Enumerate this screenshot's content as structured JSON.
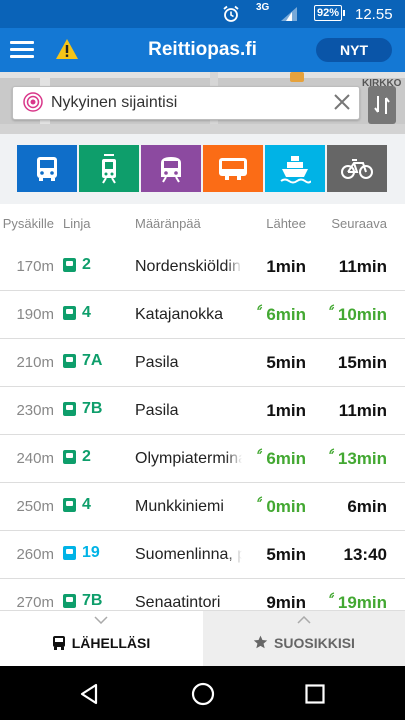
{
  "status": {
    "network": "3G",
    "battery": "92%",
    "time": "12.55"
  },
  "appbar": {
    "title": "Reittiopas.fi",
    "now_button": "NYT"
  },
  "map": {
    "street_label": "KIRKKO"
  },
  "search": {
    "value": "Nykyinen sijaintisi"
  },
  "modes": [
    {
      "name": "bus",
      "color": "#0f6ec9"
    },
    {
      "name": "tram",
      "color": "#0e9e6b"
    },
    {
      "name": "train",
      "color": "#8c4aa0"
    },
    {
      "name": "metro",
      "color": "#fb6c16"
    },
    {
      "name": "ferry",
      "color": "#00b3e6"
    },
    {
      "name": "bike",
      "color": "#666666"
    }
  ],
  "columns": {
    "stop": "Pysäkille",
    "line": "Linja",
    "destination": "Määränpää",
    "departs": "Lähtee",
    "next": "Seuraava"
  },
  "rows": [
    {
      "distance": "170m",
      "line": "2",
      "type": "tram",
      "destination": "Nordenskiöldinkatu",
      "departs": "1min",
      "departs_realtime": false,
      "next": "11min",
      "next_realtime": false
    },
    {
      "distance": "190m",
      "line": "4",
      "type": "tram",
      "destination": "Katajanokka",
      "departs": "6min",
      "departs_realtime": true,
      "next": "10min",
      "next_realtime": true
    },
    {
      "distance": "210m",
      "line": "7A",
      "type": "tram",
      "destination": "Pasila",
      "departs": "5min",
      "departs_realtime": false,
      "next": "15min",
      "next_realtime": false
    },
    {
      "distance": "230m",
      "line": "7B",
      "type": "tram",
      "destination": "Pasila",
      "departs": "1min",
      "departs_realtime": false,
      "next": "11min",
      "next_realtime": false
    },
    {
      "distance": "240m",
      "line": "2",
      "type": "tram",
      "destination": "Olympiaterminaali",
      "departs": "6min",
      "departs_realtime": true,
      "next": "13min",
      "next_realtime": true
    },
    {
      "distance": "250m",
      "line": "4",
      "type": "tram",
      "destination": "Munkkiniemi",
      "departs": "0min",
      "departs_realtime": true,
      "next": "6min",
      "next_realtime": false
    },
    {
      "distance": "260m",
      "line": "19",
      "type": "ferry",
      "destination": "Suomenlinna, pääl",
      "departs": "5min",
      "departs_realtime": false,
      "next": "13:40",
      "next_realtime": false
    },
    {
      "distance": "270m",
      "line": "7B",
      "type": "tram",
      "destination": "Senaatintori",
      "departs": "9min",
      "departs_realtime": false,
      "next": "19min",
      "next_realtime": true
    }
  ],
  "tabs": {
    "nearby": "LÄHELLÄSI",
    "favorites": "SUOSIKKISI"
  },
  "colors": {
    "tram": "#0e9e6b",
    "ferry": "#00b3e6",
    "realtime": "#43a832"
  }
}
